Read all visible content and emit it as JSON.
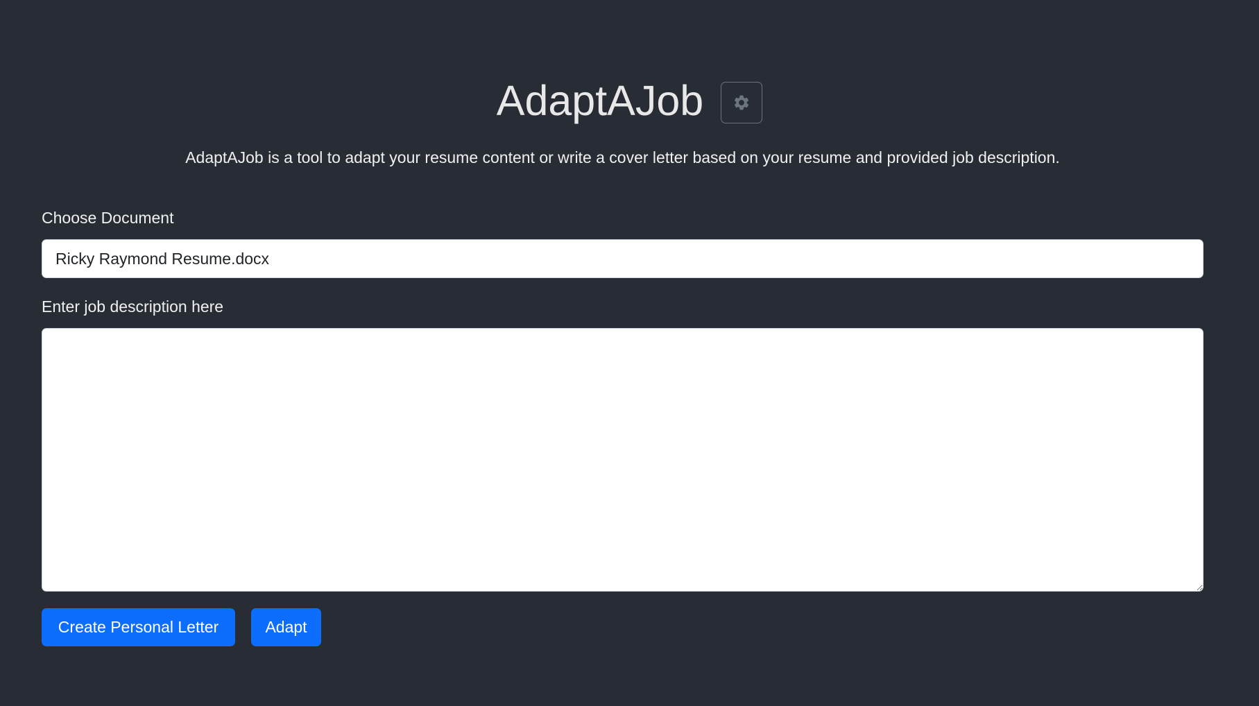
{
  "header": {
    "title": "AdaptAJob",
    "settings_icon": "gear-icon"
  },
  "description": "AdaptAJob is a tool to adapt your resume content or write a cover letter based on your resume and provided job description.",
  "document": {
    "label": "Choose Document",
    "value": "Ricky Raymond Resume.docx"
  },
  "job_description": {
    "label": "Enter job description here",
    "value": ""
  },
  "actions": {
    "create_letter_label": "Create Personal Letter",
    "adapt_label": "Adapt"
  },
  "colors": {
    "background": "#282c34",
    "primary": "#0d6efd",
    "input_bg": "#ffffff"
  }
}
